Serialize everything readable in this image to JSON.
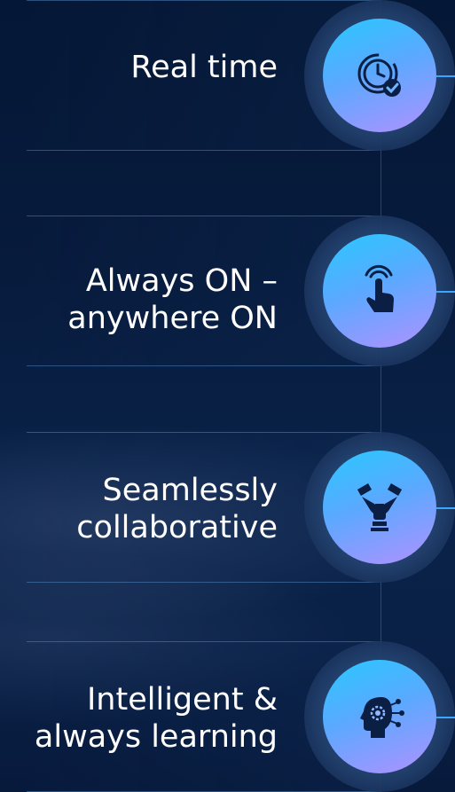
{
  "features": [
    {
      "label_lines": [
        "Real time"
      ],
      "icon": "realtime-clock-check-icon"
    },
    {
      "label_lines": [
        "Always ON –",
        "anywhere ON"
      ],
      "icon": "touch-hand-icon"
    },
    {
      "label_lines": [
        "Seamlessly",
        "collaborative"
      ],
      "icon": "collaboration-hands-icon"
    },
    {
      "label_lines": [
        "Intelligent &",
        "always learning"
      ],
      "icon": "ai-brain-head-icon"
    }
  ],
  "colors": {
    "background": "#071b3d",
    "disc_gradient_start": "#29c8ff",
    "disc_gradient_end": "#b091ff",
    "icon_color": "#0b1f45",
    "connector": "#3aa6ff"
  }
}
